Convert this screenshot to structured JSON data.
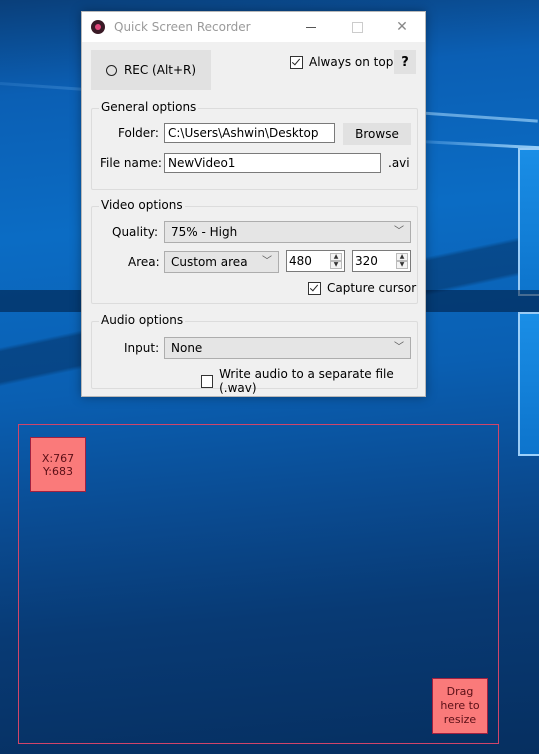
{
  "window": {
    "title": "Quick Screen Recorder",
    "minimize_icon": "minimize-icon",
    "maximize_icon": "maximize-icon",
    "close_icon": "close-icon"
  },
  "toolbar": {
    "rec_label": "REC (Alt+R)",
    "always_on_top_label": "Always on top",
    "always_on_top_checked": true,
    "help_label": "?"
  },
  "general": {
    "title": "General options",
    "folder_label": "Folder:",
    "folder_value": "C:\\Users\\Ashwin\\Desktop",
    "browse_label": "Browse",
    "filename_label": "File name:",
    "filename_value": "NewVideo1",
    "extension": ".avi"
  },
  "video": {
    "title": "Video options",
    "quality_label": "Quality:",
    "quality_value": "75% - High",
    "area_label": "Area:",
    "area_value": "Custom area",
    "width_value": "480",
    "height_value": "320",
    "capture_cursor_label": "Capture cursor",
    "capture_cursor_checked": true
  },
  "audio": {
    "title": "Audio options",
    "input_label": "Input:",
    "input_value": "None",
    "separate_file_label": "Write audio to a separate file (.wav)",
    "separate_file_checked": false
  },
  "overlay": {
    "coords_x": "X:767",
    "coords_y": "Y:683",
    "resize_line1": "Drag",
    "resize_line2": "here to",
    "resize_line3": "resize",
    "border_color": "#d0456a",
    "badge_color": "#fa7a7a"
  }
}
